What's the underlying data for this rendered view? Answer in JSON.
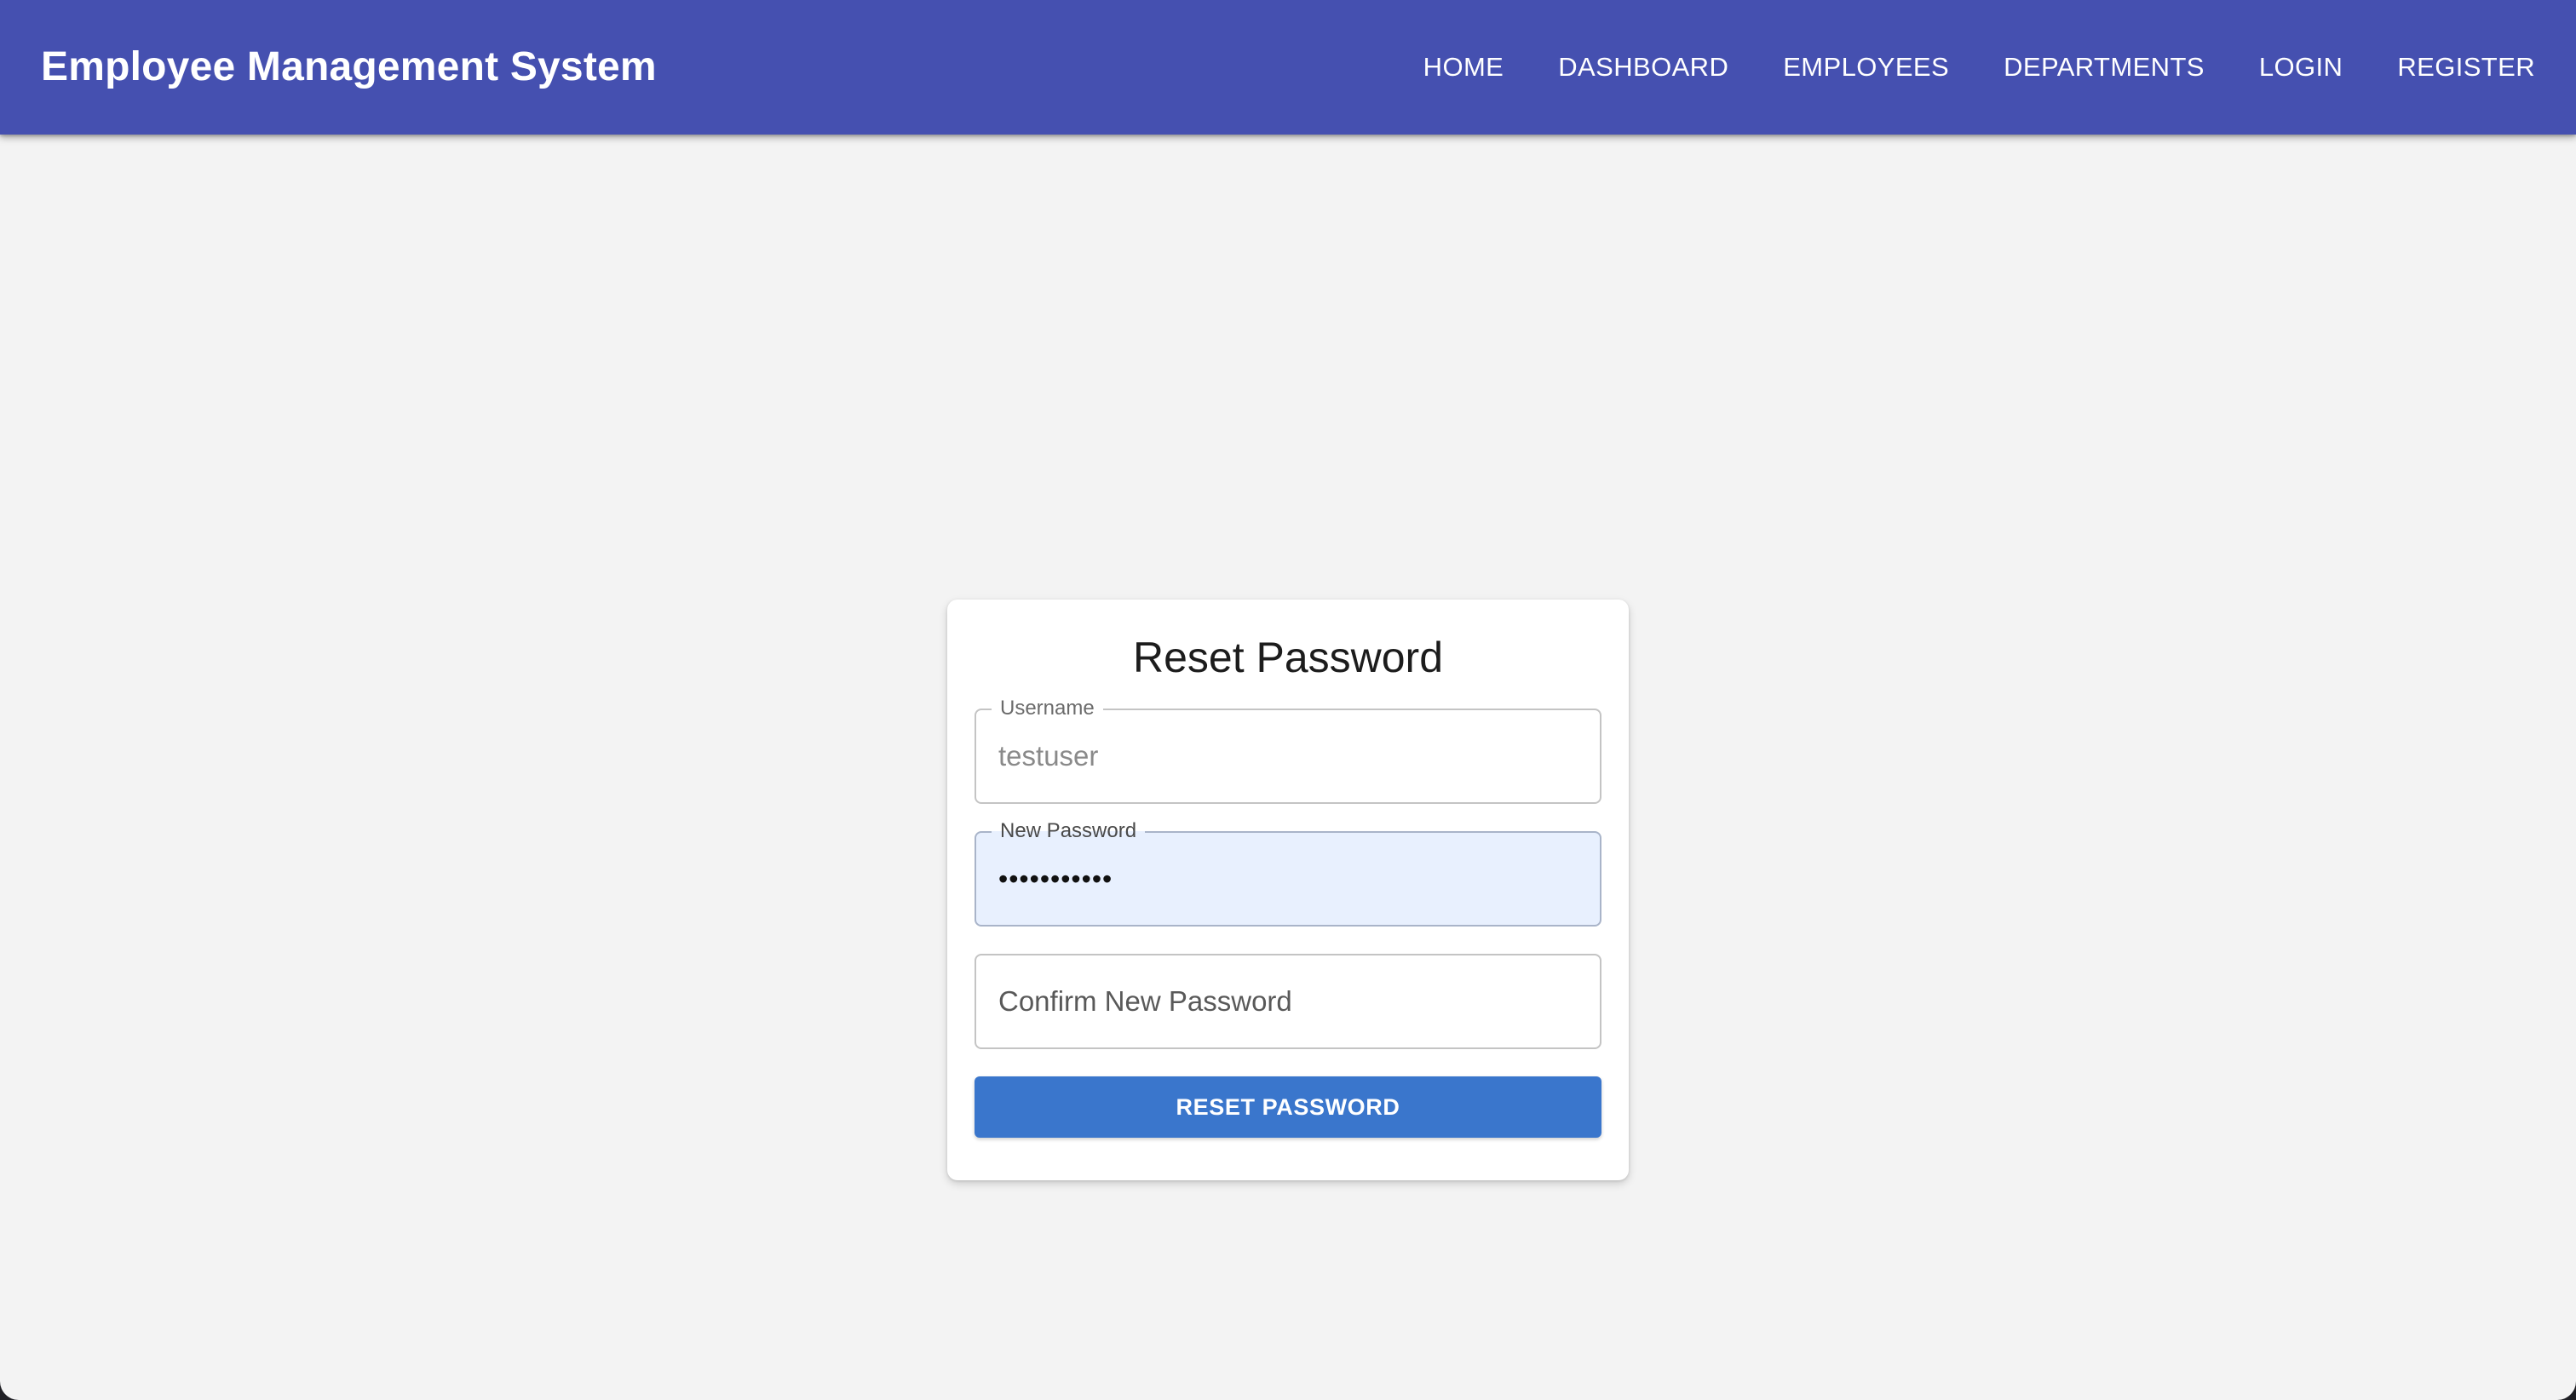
{
  "appbar": {
    "title": "Employee Management System",
    "nav": [
      {
        "label": "HOME"
      },
      {
        "label": "DASHBOARD"
      },
      {
        "label": "EMPLOYEES"
      },
      {
        "label": "DEPARTMENTS"
      },
      {
        "label": "LOGIN"
      },
      {
        "label": "REGISTER"
      }
    ]
  },
  "form": {
    "title": "Reset Password",
    "username": {
      "label": "Username",
      "value": "testuser"
    },
    "new_password": {
      "label": "New Password",
      "value": "•••••••••••"
    },
    "confirm_password": {
      "placeholder": "Confirm New Password"
    },
    "submit_label": "RESET PASSWORD"
  },
  "colors": {
    "appbar": "#4550b0",
    "button": "#3a76cc",
    "page_background": "#f3f3f3",
    "autofill_background": "#e8f0fe"
  }
}
